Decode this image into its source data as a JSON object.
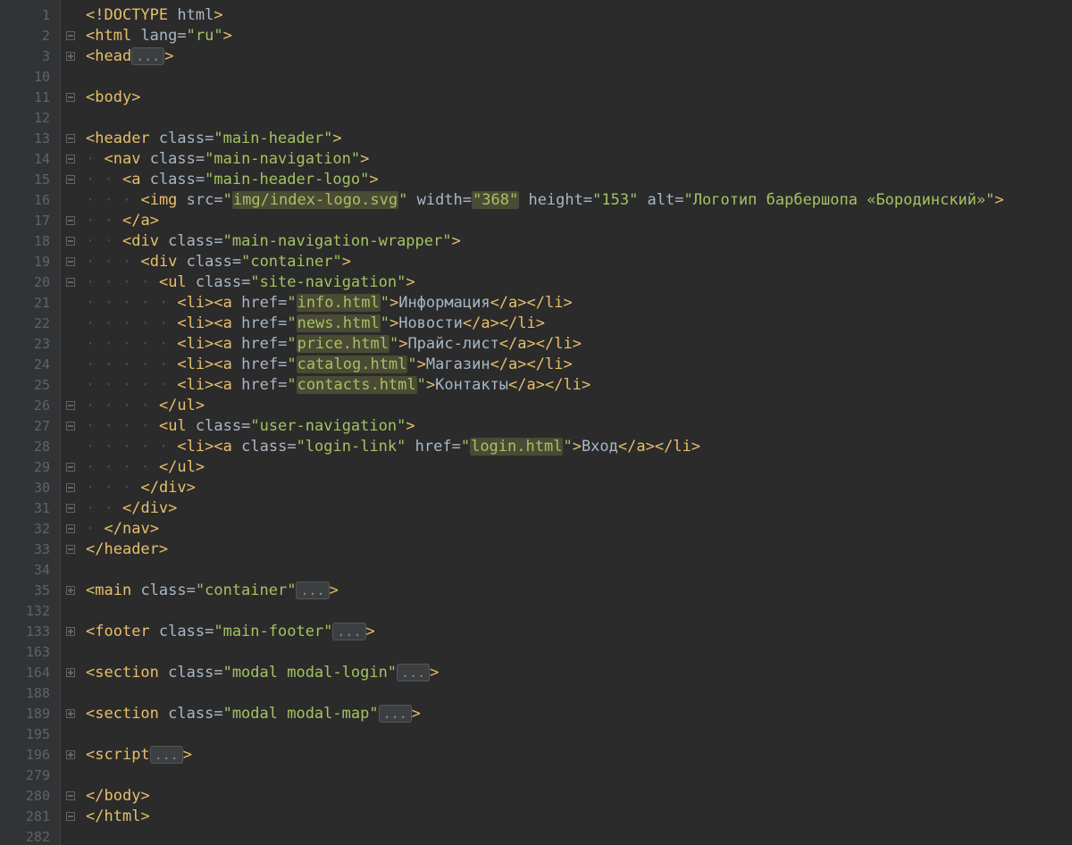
{
  "colors": {
    "background": "#2b2b2b",
    "gutter_bg": "#313335",
    "line_number": "#606366",
    "tag": "#e8bf6a",
    "attr": "#a9b7c6",
    "string": "#a5c261",
    "string_highlight_bg": "#4a4a35",
    "text": "#a9b7c6",
    "fold_pill_bg": "#3c3f41"
  },
  "fold_marker_text": "...",
  "lines": [
    {
      "num": "1",
      "fold": "",
      "indent": 0,
      "tokens": [
        {
          "c": "punct",
          "t": "<!"
        },
        {
          "c": "doctype",
          "t": "DOCTYPE "
        },
        {
          "c": "attr",
          "t": "html"
        },
        {
          "c": "punct",
          "t": ">"
        }
      ]
    },
    {
      "num": "2",
      "fold": "minus",
      "indent": 0,
      "tokens": [
        {
          "c": "punct",
          "t": "<"
        },
        {
          "c": "tag",
          "t": "html "
        },
        {
          "c": "attr",
          "t": "lang"
        },
        {
          "c": "eq",
          "t": "="
        },
        {
          "c": "str",
          "t": "\"ru\""
        },
        {
          "c": "punct",
          "t": ">"
        }
      ]
    },
    {
      "num": "3",
      "fold": "plus",
      "indent": 0,
      "tokens": [
        {
          "c": "punct",
          "t": "<"
        },
        {
          "c": "tag",
          "t": "head"
        },
        {
          "c": "fold-pill",
          "t": "..."
        },
        {
          "c": "punct",
          "t": ">"
        }
      ]
    },
    {
      "num": "10",
      "fold": "",
      "indent": 0,
      "tokens": []
    },
    {
      "num": "11",
      "fold": "minus",
      "indent": 0,
      "tokens": [
        {
          "c": "punct",
          "t": "<"
        },
        {
          "c": "tag",
          "t": "body"
        },
        {
          "c": "punct",
          "t": ">"
        }
      ]
    },
    {
      "num": "12",
      "fold": "",
      "indent": 0,
      "tokens": []
    },
    {
      "num": "13",
      "fold": "minus",
      "indent": 0,
      "tokens": [
        {
          "c": "punct",
          "t": "<"
        },
        {
          "c": "tag",
          "t": "header "
        },
        {
          "c": "attr",
          "t": "class"
        },
        {
          "c": "eq",
          "t": "="
        },
        {
          "c": "str",
          "t": "\"main-header\""
        },
        {
          "c": "punct",
          "t": ">"
        }
      ]
    },
    {
      "num": "14",
      "fold": "minus",
      "indent": 1,
      "tokens": [
        {
          "c": "punct",
          "t": "<"
        },
        {
          "c": "tag",
          "t": "nav "
        },
        {
          "c": "attr",
          "t": "class"
        },
        {
          "c": "eq",
          "t": "="
        },
        {
          "c": "str",
          "t": "\"main-navigation\""
        },
        {
          "c": "punct",
          "t": ">"
        }
      ]
    },
    {
      "num": "15",
      "fold": "minus",
      "indent": 2,
      "tokens": [
        {
          "c": "punct",
          "t": "<"
        },
        {
          "c": "tag",
          "t": "a "
        },
        {
          "c": "attr",
          "t": "class"
        },
        {
          "c": "eq",
          "t": "="
        },
        {
          "c": "str",
          "t": "\"main-header-logo\""
        },
        {
          "c": "punct",
          "t": ">"
        }
      ]
    },
    {
      "num": "16",
      "fold": "",
      "indent": 3,
      "tokens": [
        {
          "c": "punct",
          "t": "<"
        },
        {
          "c": "tag",
          "t": "img "
        },
        {
          "c": "attr",
          "t": "src"
        },
        {
          "c": "eq",
          "t": "="
        },
        {
          "c": "str",
          "t": "\""
        },
        {
          "c": "str-hl",
          "t": "img/index-logo.svg"
        },
        {
          "c": "str",
          "t": "\" "
        },
        {
          "c": "attr",
          "t": "width"
        },
        {
          "c": "eq",
          "t": "="
        },
        {
          "c": "str-hl",
          "t": "\"368\""
        },
        {
          "c": "attr",
          "t": " height"
        },
        {
          "c": "eq",
          "t": "="
        },
        {
          "c": "str",
          "t": "\"153\" "
        },
        {
          "c": "attr",
          "t": "alt"
        },
        {
          "c": "eq",
          "t": "="
        },
        {
          "c": "str",
          "t": "\"Логотип барбершопа «Бородинский»\""
        },
        {
          "c": "punct",
          "t": ">"
        }
      ]
    },
    {
      "num": "17",
      "fold": "minus",
      "indent": 2,
      "tokens": [
        {
          "c": "punct",
          "t": "</"
        },
        {
          "c": "tag",
          "t": "a"
        },
        {
          "c": "punct",
          "t": ">"
        }
      ]
    },
    {
      "num": "18",
      "fold": "minus",
      "indent": 2,
      "tokens": [
        {
          "c": "punct",
          "t": "<"
        },
        {
          "c": "tag",
          "t": "div "
        },
        {
          "c": "attr",
          "t": "class"
        },
        {
          "c": "eq",
          "t": "="
        },
        {
          "c": "str",
          "t": "\"main-navigation-wrapper\""
        },
        {
          "c": "punct",
          "t": ">"
        }
      ]
    },
    {
      "num": "19",
      "fold": "minus",
      "indent": 3,
      "tokens": [
        {
          "c": "punct",
          "t": "<"
        },
        {
          "c": "tag",
          "t": "div "
        },
        {
          "c": "attr",
          "t": "class"
        },
        {
          "c": "eq",
          "t": "="
        },
        {
          "c": "str",
          "t": "\"container\""
        },
        {
          "c": "punct",
          "t": ">"
        }
      ]
    },
    {
      "num": "20",
      "fold": "minus",
      "indent": 4,
      "tokens": [
        {
          "c": "punct",
          "t": "<"
        },
        {
          "c": "tag",
          "t": "ul "
        },
        {
          "c": "attr",
          "t": "class"
        },
        {
          "c": "eq",
          "t": "="
        },
        {
          "c": "str",
          "t": "\"site-navigation\""
        },
        {
          "c": "punct",
          "t": ">"
        }
      ]
    },
    {
      "num": "21",
      "fold": "",
      "indent": 5,
      "tokens": [
        {
          "c": "punct",
          "t": "<"
        },
        {
          "c": "tag",
          "t": "li"
        },
        {
          "c": "punct",
          "t": "><"
        },
        {
          "c": "tag",
          "t": "a "
        },
        {
          "c": "attr",
          "t": "href"
        },
        {
          "c": "eq",
          "t": "="
        },
        {
          "c": "str",
          "t": "\""
        },
        {
          "c": "str-hl",
          "t": "info.html"
        },
        {
          "c": "str",
          "t": "\""
        },
        {
          "c": "punct",
          "t": ">"
        },
        {
          "c": "txt",
          "t": "Информация"
        },
        {
          "c": "punct",
          "t": "</"
        },
        {
          "c": "tag",
          "t": "a"
        },
        {
          "c": "punct",
          "t": "></"
        },
        {
          "c": "tag",
          "t": "li"
        },
        {
          "c": "punct",
          "t": ">"
        }
      ]
    },
    {
      "num": "22",
      "fold": "",
      "indent": 5,
      "tokens": [
        {
          "c": "punct",
          "t": "<"
        },
        {
          "c": "tag",
          "t": "li"
        },
        {
          "c": "punct",
          "t": "><"
        },
        {
          "c": "tag",
          "t": "a "
        },
        {
          "c": "attr",
          "t": "href"
        },
        {
          "c": "eq",
          "t": "="
        },
        {
          "c": "str",
          "t": "\""
        },
        {
          "c": "str-hl",
          "t": "news.html"
        },
        {
          "c": "str",
          "t": "\""
        },
        {
          "c": "punct",
          "t": ">"
        },
        {
          "c": "txt",
          "t": "Новости"
        },
        {
          "c": "punct",
          "t": "</"
        },
        {
          "c": "tag",
          "t": "a"
        },
        {
          "c": "punct",
          "t": "></"
        },
        {
          "c": "tag",
          "t": "li"
        },
        {
          "c": "punct",
          "t": ">"
        }
      ]
    },
    {
      "num": "23",
      "fold": "",
      "indent": 5,
      "tokens": [
        {
          "c": "punct",
          "t": "<"
        },
        {
          "c": "tag",
          "t": "li"
        },
        {
          "c": "punct",
          "t": "><"
        },
        {
          "c": "tag",
          "t": "a "
        },
        {
          "c": "attr",
          "t": "href"
        },
        {
          "c": "eq",
          "t": "="
        },
        {
          "c": "str",
          "t": "\""
        },
        {
          "c": "str-hl",
          "t": "price.html"
        },
        {
          "c": "str",
          "t": "\""
        },
        {
          "c": "punct",
          "t": ">"
        },
        {
          "c": "txt",
          "t": "Прайс-лист"
        },
        {
          "c": "punct",
          "t": "</"
        },
        {
          "c": "tag",
          "t": "a"
        },
        {
          "c": "punct",
          "t": "></"
        },
        {
          "c": "tag",
          "t": "li"
        },
        {
          "c": "punct",
          "t": ">"
        }
      ]
    },
    {
      "num": "24",
      "fold": "",
      "indent": 5,
      "tokens": [
        {
          "c": "punct",
          "t": "<"
        },
        {
          "c": "tag",
          "t": "li"
        },
        {
          "c": "punct",
          "t": "><"
        },
        {
          "c": "tag",
          "t": "a "
        },
        {
          "c": "attr",
          "t": "href"
        },
        {
          "c": "eq",
          "t": "="
        },
        {
          "c": "str",
          "t": "\""
        },
        {
          "c": "str-hl",
          "t": "catalog.html"
        },
        {
          "c": "str",
          "t": "\""
        },
        {
          "c": "punct",
          "t": ">"
        },
        {
          "c": "txt",
          "t": "Магазин"
        },
        {
          "c": "punct",
          "t": "</"
        },
        {
          "c": "tag",
          "t": "a"
        },
        {
          "c": "punct",
          "t": "></"
        },
        {
          "c": "tag",
          "t": "li"
        },
        {
          "c": "punct",
          "t": ">"
        }
      ]
    },
    {
      "num": "25",
      "fold": "",
      "indent": 5,
      "tokens": [
        {
          "c": "punct",
          "t": "<"
        },
        {
          "c": "tag",
          "t": "li"
        },
        {
          "c": "punct",
          "t": "><"
        },
        {
          "c": "tag",
          "t": "a "
        },
        {
          "c": "attr",
          "t": "href"
        },
        {
          "c": "eq",
          "t": "="
        },
        {
          "c": "str",
          "t": "\""
        },
        {
          "c": "str-hl",
          "t": "contacts.html"
        },
        {
          "c": "str",
          "t": "\""
        },
        {
          "c": "punct",
          "t": ">"
        },
        {
          "c": "txt",
          "t": "Контакты"
        },
        {
          "c": "punct",
          "t": "</"
        },
        {
          "c": "tag",
          "t": "a"
        },
        {
          "c": "punct",
          "t": "></"
        },
        {
          "c": "tag",
          "t": "li"
        },
        {
          "c": "punct",
          "t": ">"
        }
      ]
    },
    {
      "num": "26",
      "fold": "minus",
      "indent": 4,
      "tokens": [
        {
          "c": "punct",
          "t": "</"
        },
        {
          "c": "tag",
          "t": "ul"
        },
        {
          "c": "punct",
          "t": ">"
        }
      ]
    },
    {
      "num": "27",
      "fold": "minus",
      "indent": 4,
      "tokens": [
        {
          "c": "punct",
          "t": "<"
        },
        {
          "c": "tag",
          "t": "ul "
        },
        {
          "c": "attr",
          "t": "class"
        },
        {
          "c": "eq",
          "t": "="
        },
        {
          "c": "str",
          "t": "\"user-navigation\""
        },
        {
          "c": "punct",
          "t": ">"
        }
      ]
    },
    {
      "num": "28",
      "fold": "",
      "indent": 5,
      "tokens": [
        {
          "c": "punct",
          "t": "<"
        },
        {
          "c": "tag",
          "t": "li"
        },
        {
          "c": "punct",
          "t": "><"
        },
        {
          "c": "tag",
          "t": "a "
        },
        {
          "c": "attr",
          "t": "class"
        },
        {
          "c": "eq",
          "t": "="
        },
        {
          "c": "str",
          "t": "\"login-link\" "
        },
        {
          "c": "attr",
          "t": "href"
        },
        {
          "c": "eq",
          "t": "="
        },
        {
          "c": "str",
          "t": "\""
        },
        {
          "c": "str-hl",
          "t": "login.html"
        },
        {
          "c": "str",
          "t": "\""
        },
        {
          "c": "punct",
          "t": ">"
        },
        {
          "c": "txt",
          "t": "Вход"
        },
        {
          "c": "punct",
          "t": "</"
        },
        {
          "c": "tag",
          "t": "a"
        },
        {
          "c": "punct",
          "t": "></"
        },
        {
          "c": "tag",
          "t": "li"
        },
        {
          "c": "punct",
          "t": ">"
        }
      ]
    },
    {
      "num": "29",
      "fold": "minus",
      "indent": 4,
      "tokens": [
        {
          "c": "punct",
          "t": "</"
        },
        {
          "c": "tag",
          "t": "ul"
        },
        {
          "c": "punct",
          "t": ">"
        }
      ]
    },
    {
      "num": "30",
      "fold": "minus",
      "indent": 3,
      "tokens": [
        {
          "c": "punct",
          "t": "</"
        },
        {
          "c": "tag",
          "t": "div"
        },
        {
          "c": "punct",
          "t": ">"
        }
      ]
    },
    {
      "num": "31",
      "fold": "minus",
      "indent": 2,
      "tokens": [
        {
          "c": "punct",
          "t": "</"
        },
        {
          "c": "tag",
          "t": "div"
        },
        {
          "c": "punct",
          "t": ">"
        }
      ]
    },
    {
      "num": "32",
      "fold": "minus",
      "indent": 1,
      "tokens": [
        {
          "c": "punct",
          "t": "</"
        },
        {
          "c": "tag",
          "t": "nav"
        },
        {
          "c": "punct",
          "t": ">"
        }
      ]
    },
    {
      "num": "33",
      "fold": "minus",
      "indent": 0,
      "tokens": [
        {
          "c": "punct",
          "t": "</"
        },
        {
          "c": "tag",
          "t": "header"
        },
        {
          "c": "punct",
          "t": ">"
        }
      ]
    },
    {
      "num": "34",
      "fold": "",
      "indent": 0,
      "tokens": []
    },
    {
      "num": "35",
      "fold": "plus",
      "indent": 0,
      "tokens": [
        {
          "c": "punct",
          "t": "<"
        },
        {
          "c": "tag",
          "t": "main "
        },
        {
          "c": "attr",
          "t": "class"
        },
        {
          "c": "eq",
          "t": "="
        },
        {
          "c": "str",
          "t": "\"container\""
        },
        {
          "c": "fold-pill",
          "t": "..."
        },
        {
          "c": "punct",
          "t": ">"
        }
      ]
    },
    {
      "num": "132",
      "fold": "",
      "indent": 0,
      "tokens": []
    },
    {
      "num": "133",
      "fold": "plus",
      "indent": 0,
      "tokens": [
        {
          "c": "punct",
          "t": "<"
        },
        {
          "c": "tag",
          "t": "footer "
        },
        {
          "c": "attr",
          "t": "class"
        },
        {
          "c": "eq",
          "t": "="
        },
        {
          "c": "str",
          "t": "\"main-footer\""
        },
        {
          "c": "fold-pill",
          "t": "..."
        },
        {
          "c": "punct",
          "t": ">"
        }
      ]
    },
    {
      "num": "163",
      "fold": "",
      "indent": 0,
      "tokens": []
    },
    {
      "num": "164",
      "fold": "plus",
      "indent": 0,
      "tokens": [
        {
          "c": "punct",
          "t": "<"
        },
        {
          "c": "tag",
          "t": "section "
        },
        {
          "c": "attr",
          "t": "class"
        },
        {
          "c": "eq",
          "t": "="
        },
        {
          "c": "str",
          "t": "\"modal modal-login\""
        },
        {
          "c": "fold-pill",
          "t": "..."
        },
        {
          "c": "punct",
          "t": ">"
        }
      ]
    },
    {
      "num": "188",
      "fold": "",
      "indent": 0,
      "tokens": []
    },
    {
      "num": "189",
      "fold": "plus",
      "indent": 0,
      "tokens": [
        {
          "c": "punct",
          "t": "<"
        },
        {
          "c": "tag",
          "t": "section "
        },
        {
          "c": "attr",
          "t": "class"
        },
        {
          "c": "eq",
          "t": "="
        },
        {
          "c": "str",
          "t": "\"modal modal-map\""
        },
        {
          "c": "fold-pill",
          "t": "..."
        },
        {
          "c": "punct",
          "t": ">"
        }
      ]
    },
    {
      "num": "195",
      "fold": "",
      "indent": 0,
      "tokens": []
    },
    {
      "num": "196",
      "fold": "plus",
      "indent": 0,
      "tokens": [
        {
          "c": "punct",
          "t": "<"
        },
        {
          "c": "tag",
          "t": "script"
        },
        {
          "c": "fold-pill",
          "t": "..."
        },
        {
          "c": "punct",
          "t": ">"
        }
      ]
    },
    {
      "num": "279",
      "fold": "",
      "indent": 0,
      "tokens": []
    },
    {
      "num": "280",
      "fold": "minus",
      "indent": 0,
      "tokens": [
        {
          "c": "punct",
          "t": "</"
        },
        {
          "c": "tag",
          "t": "body"
        },
        {
          "c": "punct",
          "t": ">"
        }
      ]
    },
    {
      "num": "281",
      "fold": "minus",
      "indent": 0,
      "tokens": [
        {
          "c": "punct",
          "t": "</"
        },
        {
          "c": "tag",
          "t": "html"
        },
        {
          "c": "punct",
          "t": ">"
        }
      ]
    },
    {
      "num": "282",
      "fold": "",
      "indent": 0,
      "tokens": []
    }
  ]
}
